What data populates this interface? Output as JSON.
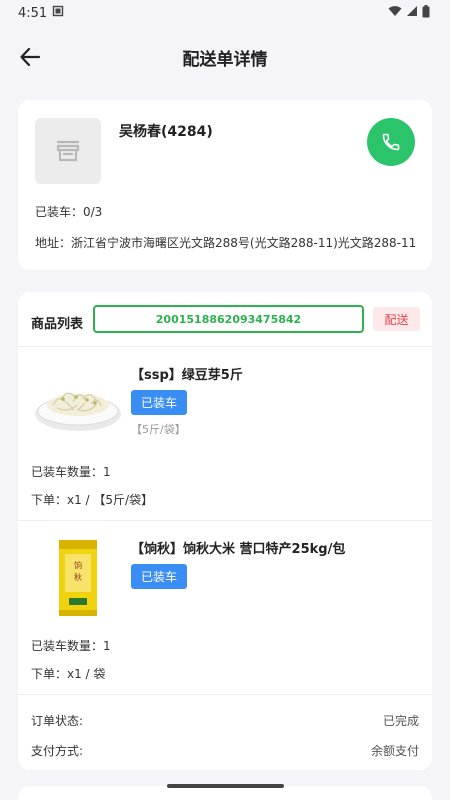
{
  "status_bar": {
    "time": "4:51"
  },
  "header": {
    "title": "配送单详情"
  },
  "customer": {
    "name": "吴杨春(4284)",
    "loaded": "已装车：0/3",
    "address": "地址：浙江省宁波市海曙区光文路288号(光文路288-11)光文路288-11"
  },
  "goods": {
    "label": "商品列表",
    "code": "2001518862093475842",
    "deliver_tag": "配送",
    "items": [
      {
        "name": "【ssp】绿豆芽5斤",
        "badge": "已装车",
        "spec": "【5斤/袋】",
        "loaded_qty": "已装车数量：1",
        "order": "下单：x1 / 【5斤/袋】"
      },
      {
        "name": "【饷秋】饷秋大米 营口特产25kg/包",
        "badge": "已装车",
        "spec": "",
        "loaded_qty": "已装车数量：1",
        "order": "下单：x1 / 袋"
      }
    ]
  },
  "order_info": {
    "status_label": "订单状态:",
    "status_value": "已完成",
    "pay_label": "支付方式:",
    "pay_value": "余额支付"
  },
  "colors": {
    "accent_green": "#2cc46a",
    "code_green": "#2eb24f",
    "badge_blue": "#3a8ef3",
    "tag_red": "#e5454f"
  }
}
